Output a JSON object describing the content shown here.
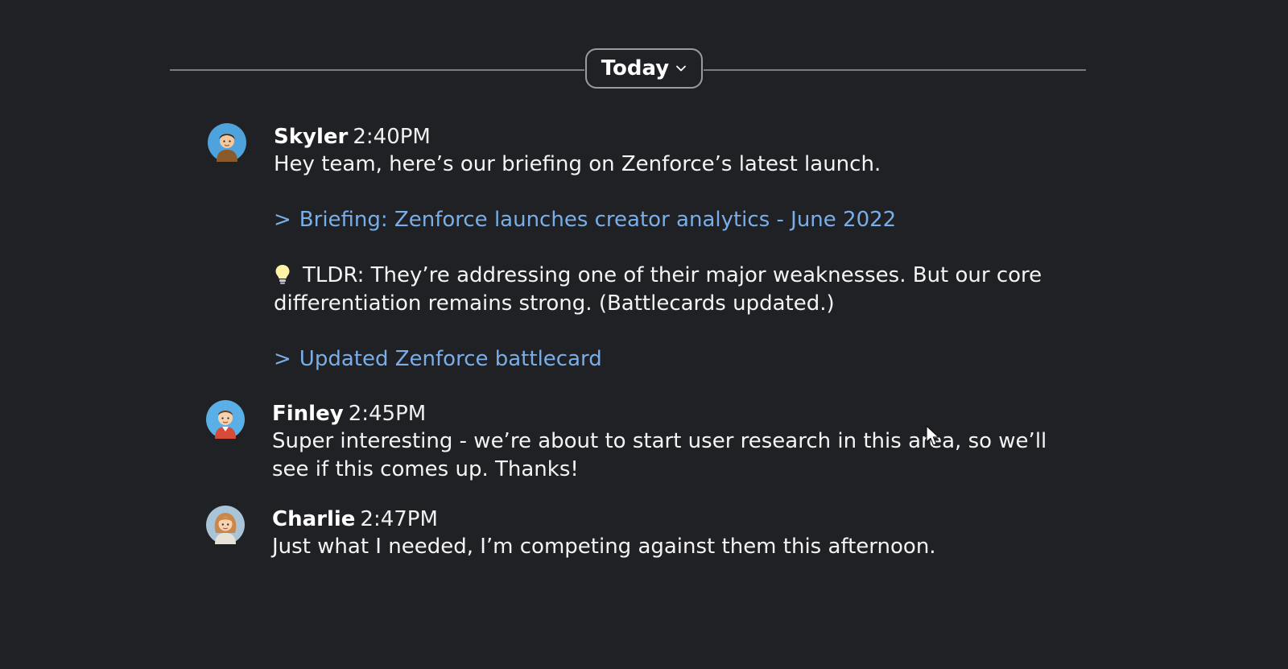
{
  "divider": {
    "label": "Today"
  },
  "messages": [
    {
      "author": "Skyler",
      "time": "2:40PM",
      "intro": "Hey team, here’s our briefing on Zenforce’s latest launch.",
      "link1": "Briefing: Zenforce launches creator analytics - June 2022",
      "tldr": "TLDR: They’re addressing one of their major weaknesses. But our core differentiation remains strong. (Battlecards updated.)",
      "link2": "Updated Zenforce battlecard"
    },
    {
      "author": "Finley",
      "time": "2:45PM",
      "text": "Super interesting - we’re about to start user research in this area, so we’ll see if this comes up. Thanks!"
    },
    {
      "author": "Charlie",
      "time": "2:47PM",
      "text": "Just what I needed, I’m competing against them this afternoon."
    }
  ],
  "icons": {
    "chevron": ">",
    "dropdown": "chevron-down-icon",
    "idea": "lightbulb-icon"
  },
  "colors": {
    "background": "#202125",
    "link": "#79aee8",
    "text": "#f4f4f4"
  }
}
